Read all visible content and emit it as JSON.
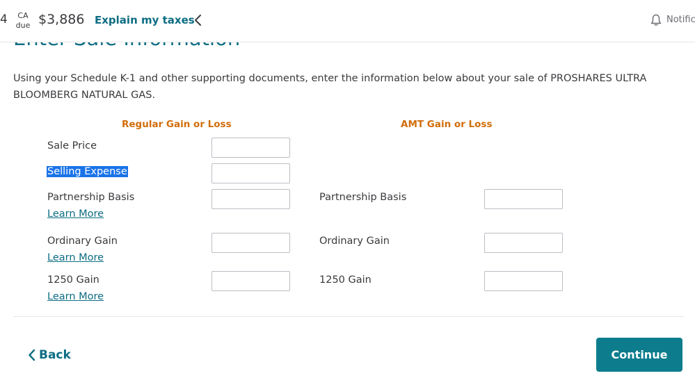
{
  "topbar": {
    "fed_fragment": "4",
    "state_code": "CA",
    "state_status": "due",
    "amount": "$3,886",
    "explain_label": "Explain my taxes",
    "notifications_label": "Notifica"
  },
  "page": {
    "title": "Enter Sale Information",
    "intro": "Using your Schedule K-1 and other supporting documents, enter the information below about your sale of PROSHARES ULTRA BLOOMBERG NATURAL GAS."
  },
  "columns": {
    "regular_heading": "Regular Gain or Loss",
    "amt_heading": "AMT Gain or Loss"
  },
  "regular_rows": {
    "sale_price": {
      "label": "Sale Price",
      "value": ""
    },
    "selling_expense": {
      "label": "Selling Expense",
      "value": ""
    },
    "partnership_basis": {
      "label": "Partnership Basis",
      "value": "",
      "learn_more": "Learn More"
    },
    "ordinary_gain": {
      "label": "Ordinary Gain",
      "value": "",
      "learn_more": "Learn More"
    },
    "gain_1250": {
      "label": "1250 Gain",
      "value": "",
      "learn_more": "Learn More"
    }
  },
  "amt_rows": {
    "partnership_basis": {
      "label": "Partnership Basis",
      "value": ""
    },
    "ordinary_gain": {
      "label": "Ordinary Gain",
      "value": ""
    },
    "gain_1250": {
      "label": "1250 Gain",
      "value": ""
    }
  },
  "footer": {
    "back_label": "Back",
    "continue_label": "Continue"
  },
  "colors": {
    "accent": "#0d6d83",
    "column_heading": "#d16d0a",
    "continue_button": "#0d7d8e",
    "selection": "#1a73e8"
  }
}
